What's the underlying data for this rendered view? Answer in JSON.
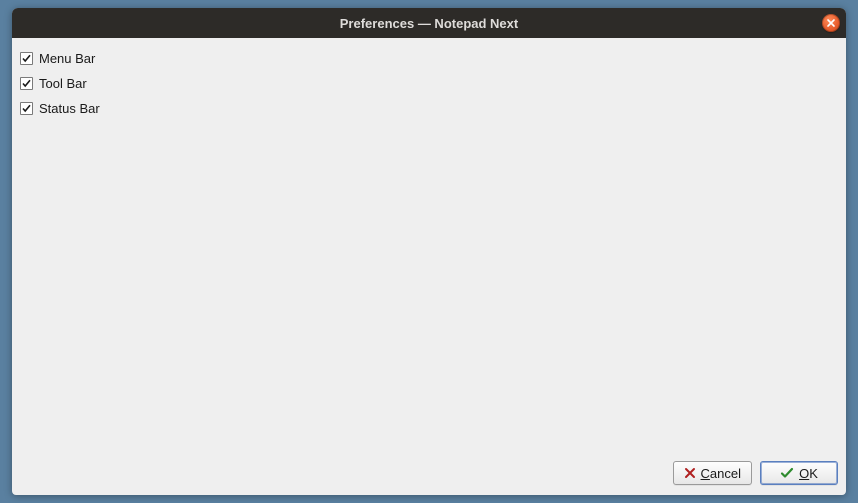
{
  "title": "Preferences — Notepad Next",
  "options": [
    {
      "label": "Menu Bar",
      "checked": true
    },
    {
      "label": "Tool Bar",
      "checked": true
    },
    {
      "label": "Status Bar",
      "checked": true
    }
  ],
  "buttons": {
    "cancel": {
      "label_plain": "Cancel",
      "accel_index": 0
    },
    "ok": {
      "label_plain": "OK",
      "accel_index": 0
    }
  }
}
